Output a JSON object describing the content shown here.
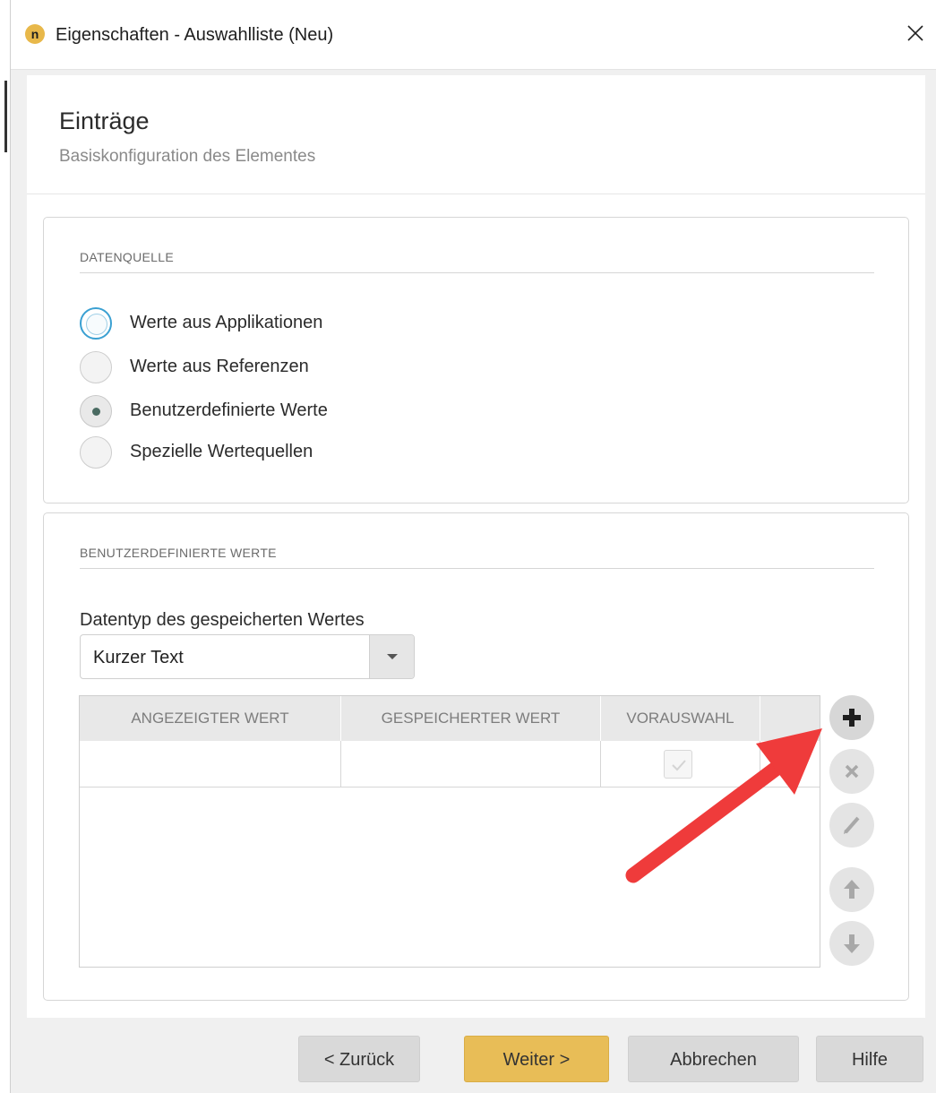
{
  "window": {
    "title": "Eigenschaften - Auswahlliste (Neu)",
    "logo_letter": "n"
  },
  "header": {
    "title": "Einträge",
    "subtitle": "Basiskonfiguration des Elementes"
  },
  "datasource": {
    "section_title": "DATENQUELLE",
    "options": [
      {
        "label": "Werte aus Applikationen",
        "state": "focused"
      },
      {
        "label": "Werte aus Referenzen",
        "state": "unchecked"
      },
      {
        "label": "Benutzerdefinierte Werte",
        "state": "checked"
      },
      {
        "label": "Spezielle Wertequellen",
        "state": "unchecked"
      }
    ]
  },
  "custom_values": {
    "section_title": "BENUTZERDEFINIERTE WERTE",
    "datatype_label": "Datentyp des gespeicherten Wertes",
    "datatype_value": "Kurzer Text",
    "columns": [
      "ANGEZEIGTER WERT",
      "GESPEICHERTER WERT",
      "VORAUSWAHL"
    ],
    "side_buttons": [
      "plus-icon",
      "delete-icon",
      "edit-icon",
      "arrow-up-icon",
      "arrow-down-icon"
    ]
  },
  "footer": {
    "back_label": "< Zurück",
    "next_label": "Weiter >",
    "cancel_label": "Abbrechen",
    "help_label": "Hilfe"
  },
  "colors": {
    "accent": "#e8bd57",
    "focus": "#3aa0d2",
    "annotation_arrow": "#ef3b3b"
  }
}
